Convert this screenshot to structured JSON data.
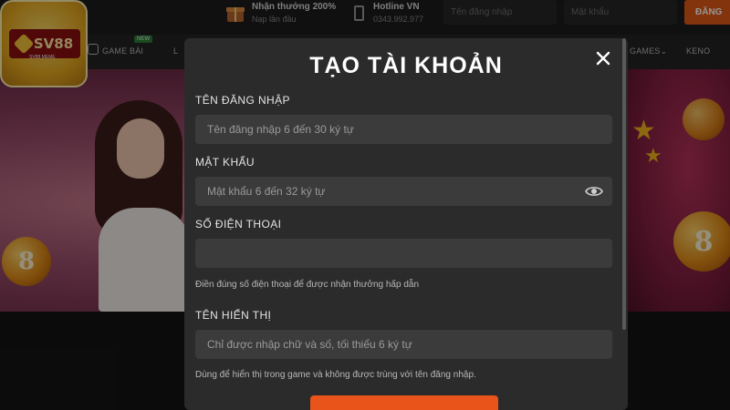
{
  "header": {
    "promo_title": "Nhận thưởng 200%",
    "promo_sub": "Nạp lần đầu",
    "hotline_title": "Hotline VN",
    "hotline_number": "0343.992.977",
    "username_placeholder": "Tên đăng nhập",
    "password_placeholder": "Mật khẩu",
    "login_label": "ĐĂNG"
  },
  "logo": {
    "text": "SV88",
    "sub": "SV88.MEME"
  },
  "nav": {
    "items": [
      "GAME BÀI",
      "L",
      "GAMES",
      "KENO"
    ],
    "new_badge": "NEW"
  },
  "banner": {
    "coin_number": "8"
  },
  "modal": {
    "title": "TẠO TÀI KHOẢN",
    "fields": [
      {
        "label": "TÊN ĐĂNG NHẬP",
        "placeholder": "Tên đăng nhập 6 đến 30 ký tự",
        "hint": ""
      },
      {
        "label": "MẬT KHẨU",
        "placeholder": "Mật khẩu 6 đến 32 ký tự",
        "hint": ""
      },
      {
        "label": "SỐ ĐIỆN THOẠI",
        "placeholder": "",
        "hint": "Điền đúng số điện thoại để được nhận thưởng hấp dẫn"
      },
      {
        "label": "TÊN HIỂN THỊ",
        "placeholder": "Chỉ được nhập chữ và số, tối thiểu 6 ký tự",
        "hint": "Dùng để hiển thị trong game và không được trùng với tên đăng nhập."
      }
    ]
  },
  "colors": {
    "accent": "#e8541a",
    "modal_bg": "#2b2b2b",
    "input_bg": "#3b3b3b"
  },
  "icons": [
    "gift-icon",
    "phone-icon",
    "close-icon",
    "eye-icon",
    "chevron-down-icon"
  ]
}
